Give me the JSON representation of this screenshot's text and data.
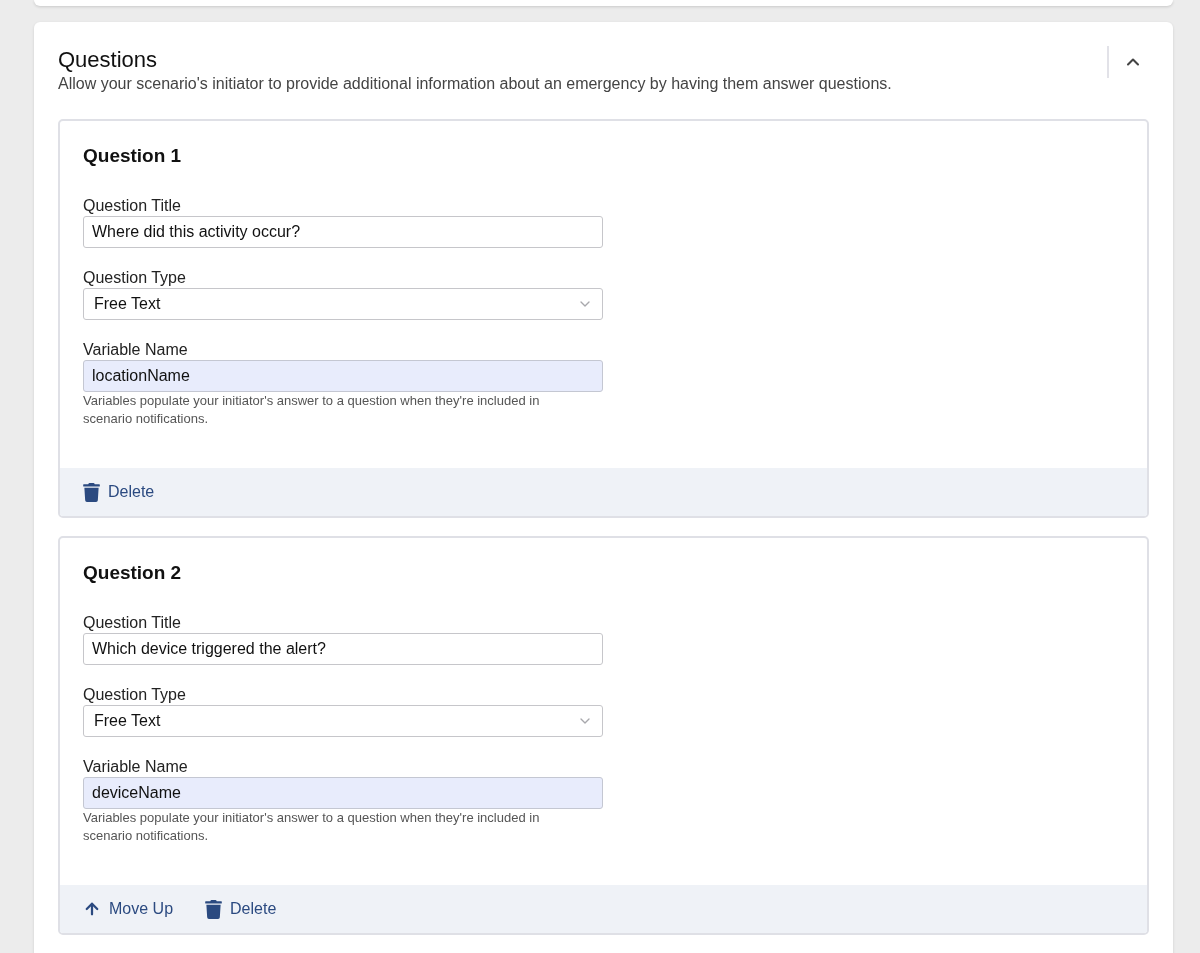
{
  "questions_section": {
    "title": "Questions",
    "description": "Allow your scenario's initiator to provide additional information about an emergency by having them answer questions.",
    "collapse_toggle": {
      "expanded": true
    },
    "questions": [
      {
        "heading": "Question 1",
        "fields": [
          {
            "kind": "text",
            "label": "Question Title",
            "value": "Where did this activity occur?",
            "autofilled": false
          },
          {
            "kind": "select",
            "label": "Question Type",
            "value": "Free Text"
          },
          {
            "kind": "text",
            "label": "Variable Name",
            "value": "locationName",
            "autofilled": true,
            "help": "Variables populate your initiator's answer to a question when they're included in scenario notifications."
          }
        ],
        "actions": [
          {
            "kind": "delete",
            "label": "Delete"
          }
        ]
      },
      {
        "heading": "Question 2",
        "fields": [
          {
            "kind": "text",
            "label": "Question Title",
            "value": "Which device triggered the alert?",
            "autofilled": false
          },
          {
            "kind": "select",
            "label": "Question Type",
            "value": "Free Text"
          },
          {
            "kind": "text",
            "label": "Variable Name",
            "value": "deviceName",
            "autofilled": true,
            "help": "Variables populate your initiator's answer to a question when they're included in scenario notifications."
          }
        ],
        "actions": [
          {
            "kind": "move_up",
            "label": "Move Up"
          },
          {
            "kind": "delete",
            "label": "Delete"
          }
        ]
      }
    ]
  }
}
